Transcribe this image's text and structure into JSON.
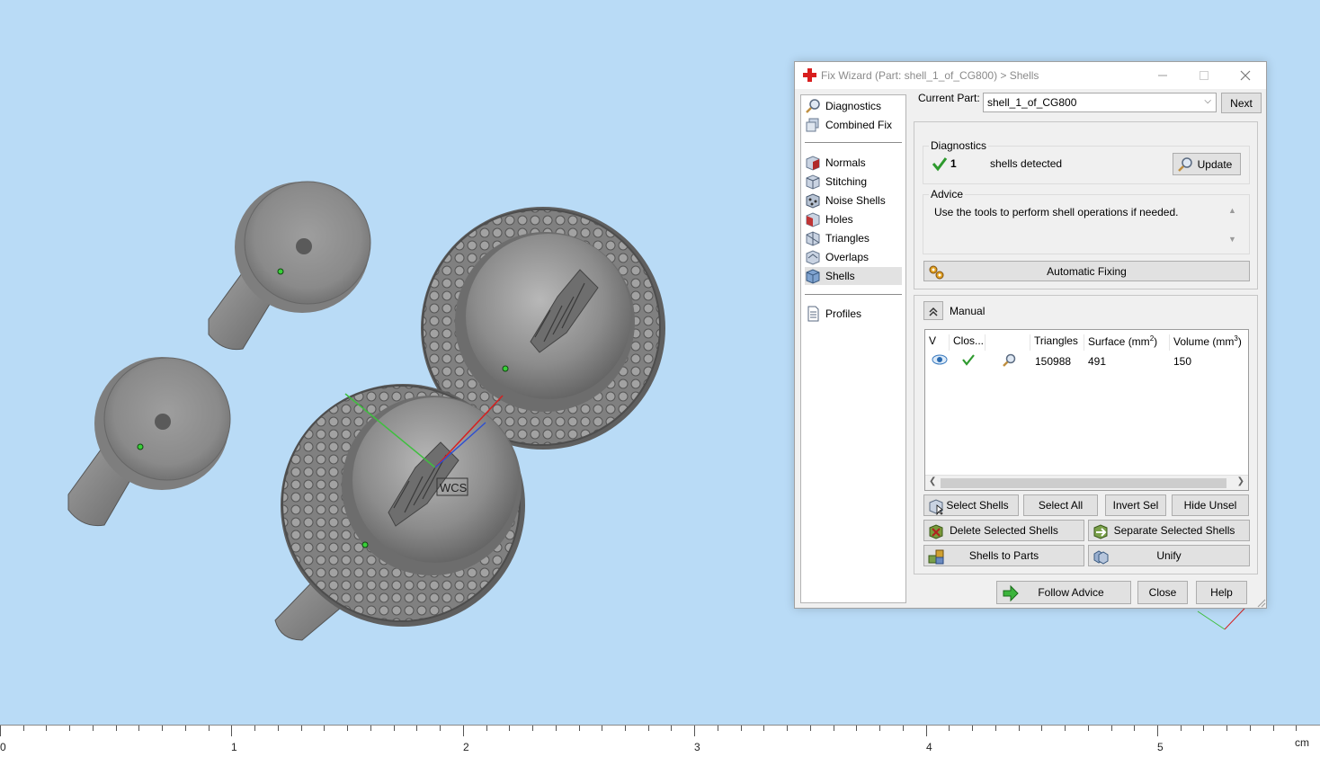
{
  "viewport": {
    "wcs_label": "WCS"
  },
  "ruler": {
    "numbers": [
      "0",
      "1",
      "2",
      "3",
      "4",
      "5"
    ],
    "unit": "cm"
  },
  "dialog": {
    "title": "Fix Wizard (Part: shell_1_of_CG800) > Shells",
    "nav": {
      "diagnostics": "Diagnostics",
      "combined_fix": "Combined Fix",
      "normals": "Normals",
      "stitching": "Stitching",
      "noise_shells": "Noise Shells",
      "holes": "Holes",
      "triangles": "Triangles",
      "overlaps": "Overlaps",
      "shells": "Shells",
      "profiles": "Profiles"
    },
    "current_part_label": "Current Part:",
    "current_part_value": "shell_1_of_CG800",
    "next_label": "Next",
    "diagnostics": {
      "title": "Diagnostics",
      "count": "1",
      "text": "shells detected",
      "update_label": "Update"
    },
    "advice": {
      "title": "Advice",
      "text": "Use the tools to perform shell operations if needed."
    },
    "automatic_fixing_label": "Automatic Fixing",
    "manual": {
      "title": "Manual",
      "columns": {
        "v": "V",
        "closed": "Clos...",
        "triangles": "Triangles",
        "surface": "Surface (mm",
        "surface_sup": "2",
        "volume": "Volume (mm",
        "volume_sup": "3"
      },
      "row": {
        "triangles": "150988",
        "surface": "491",
        "volume": "150"
      },
      "buttons": {
        "select_shells": "Select Shells",
        "select_all": "Select All",
        "invert_sel": "Invert Sel",
        "hide_unsel": "Hide Unsel",
        "delete_selected_shells": "Delete Selected Shells",
        "separate_selected_shells": "Separate Selected Shells",
        "shells_to_parts": "Shells to Parts",
        "unify": "Unify"
      }
    },
    "footer": {
      "follow_advice": "Follow Advice",
      "close": "Close",
      "help": "Help"
    }
  },
  "colors": {
    "background": "#b9dbf6",
    "model_gray": "#8a8a8a",
    "check_green": "#2e9a2e",
    "axis_x": "#d62020",
    "axis_y": "#3fbf3f",
    "axis_z": "#3050d0"
  }
}
